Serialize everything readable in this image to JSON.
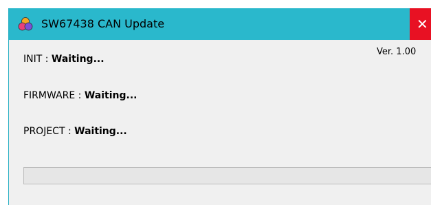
{
  "window": {
    "title": "SW67438 CAN Update",
    "close_glyph": "✕"
  },
  "version": "Ver. 1.00",
  "status": {
    "init": {
      "label": "INIT :",
      "value": "Waiting..."
    },
    "firmware": {
      "label": "FIRMWARE :",
      "value": "Waiting..."
    },
    "project": {
      "label": "PROJECT :",
      "value": "Waiting..."
    }
  },
  "progress": {
    "value": 0
  },
  "icons": {
    "app_icon": "app-logo-icon",
    "close_icon": "close-icon"
  },
  "colors": {
    "titlebar": "#2ab8cc",
    "close": "#e81123",
    "window_bg": "#f0f0f0"
  }
}
